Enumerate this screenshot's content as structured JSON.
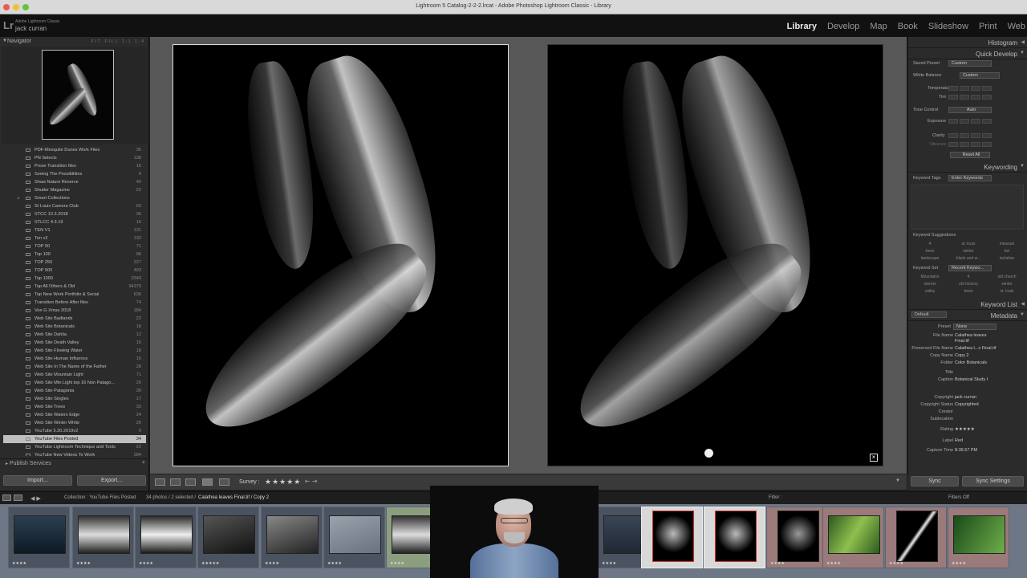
{
  "window": {
    "title": "Lightroom 5 Catalog-2-2-2.lrcat - Adobe Photoshop Lightroom Classic - Library"
  },
  "app": {
    "logo": "Lr",
    "name": "Adobe Lightroom Classic",
    "user": "jack curran"
  },
  "modules": [
    "Library",
    "Develop",
    "Map",
    "Book",
    "Slideshow",
    "Print",
    "Web"
  ],
  "navigator": {
    "title": "Navigator",
    "zoom": "FIT  FILL  1:1  1:4"
  },
  "collections": [
    {
      "name": "PDF-Mesquite Dunes Work Files",
      "count": "35"
    },
    {
      "name": "PN Selects",
      "count": "138"
    },
    {
      "name": "Prose Transition files",
      "count": "16"
    },
    {
      "name": "Seeing The Possibilities",
      "count": "6"
    },
    {
      "name": "Shaw Nature Reserve",
      "count": "40"
    },
    {
      "name": "Shutter Magazine",
      "count": "22"
    },
    {
      "name": "Smart Collections",
      "count": "",
      "expand": "▸"
    },
    {
      "name": "St Louis Camera Club",
      "count": "63"
    },
    {
      "name": "STCC 10.3.2018",
      "count": "36"
    },
    {
      "name": "STLCC 4.3.19",
      "count": "16"
    },
    {
      "name": "TEN V1",
      "count": "131"
    },
    {
      "name": "Ten v2",
      "count": "132"
    },
    {
      "name": "TOP 50",
      "count": "71"
    },
    {
      "name": "Top 100",
      "count": "96"
    },
    {
      "name": "TOP 250",
      "count": "227"
    },
    {
      "name": "TOP 500",
      "count": "493"
    },
    {
      "name": "Top 1000",
      "count": "3343"
    },
    {
      "name": "Top All Others & Old",
      "count": "94370"
    },
    {
      "name": "Top New Work Portfolio & Social",
      "count": "636"
    },
    {
      "name": "Transition Before After files",
      "count": "74"
    },
    {
      "name": "Von G Xmas 2018",
      "count": "184"
    },
    {
      "name": "Web Site Badlands",
      "count": "22"
    },
    {
      "name": "Web Site Botanicals",
      "count": "18"
    },
    {
      "name": "Web Site Dahlia",
      "count": "12"
    },
    {
      "name": "Web Site Death Valley",
      "count": "16"
    },
    {
      "name": "Web Site Flowing Water",
      "count": "18"
    },
    {
      "name": "Web Site Human Influence",
      "count": "16"
    },
    {
      "name": "Web Site In The Name of the Father",
      "count": "28"
    },
    {
      "name": "Web Site Mountain Light",
      "count": "71"
    },
    {
      "name": "Web Site Mtn Light top 16 Non Patago...",
      "count": "20"
    },
    {
      "name": "Web Site Patagonia",
      "count": "30"
    },
    {
      "name": "Web Site Singles",
      "count": "17"
    },
    {
      "name": "Web Site Trees",
      "count": "33"
    },
    {
      "name": "Web Site Waters Edge",
      "count": "24"
    },
    {
      "name": "Web Site Winter White",
      "count": "20"
    },
    {
      "name": "YouTube 5.20.2019v2",
      "count": "6"
    },
    {
      "name": "YouTube Files Posted",
      "count": "34",
      "selected": true
    },
    {
      "name": "YouTube Lightroom Technique and Tools",
      "count": "22"
    },
    {
      "name": "YouTube New Videos To Work",
      "count": "284"
    }
  ],
  "publish": {
    "label": "Publish Services",
    "plus": "+"
  },
  "left_buttons": {
    "import": "Import...",
    "export": "Export..."
  },
  "toolbar": {
    "survey": "Survey :",
    "stars": "★★★★★",
    "arrows": "⇤ ⇥"
  },
  "right_panel": {
    "histogram": "Histogram",
    "quick_develop": "Quick Develop",
    "saved_preset_label": "Saved Preset",
    "saved_preset_value": "Custom",
    "white_balance_label": "White Balance",
    "white_balance_value": "Custom",
    "temperature": "Temperature",
    "tint": "Tint",
    "tone_control": "Tone Control",
    "auto": "Auto",
    "exposure": "Exposure",
    "clarity": "Clarity",
    "vibrance": "Vibrance",
    "reset_all": "Reset All",
    "keywording": "Keywording",
    "keyword_tags_label": "Keyword Tags",
    "keyword_tags_value": "Enter Keywords",
    "keyword_suggestions": "Keyword Suggestions",
    "suggestions": [
      "4",
      "st. louis",
      "missouri",
      "trees",
      "winter",
      "bw",
      "landscape",
      "black and w...",
      "isolation"
    ],
    "keyword_set_label": "Keyword Set",
    "keyword_set_value": "Recent Keywo...",
    "keyword_set_items": [
      "Mountains",
      "4",
      "old church",
      "storms",
      "old hickory",
      "winter",
      "valley",
      "trees",
      "st. louis"
    ],
    "keyword_list": "Keyword List",
    "metadata": "Metadata",
    "metadata_preset_select": "Default",
    "preset_label": "Preset",
    "preset_value": "None",
    "meta": [
      {
        "label": "File Name",
        "value": "Calathea leaves Final.tif"
      },
      {
        "label": "Preserved File Name",
        "value": "Calathea l...s Final.tif"
      },
      {
        "label": "Copy Name",
        "value": "Copy 2"
      },
      {
        "label": "Folder",
        "value": "Color Botanicals"
      },
      {
        "label": "Title",
        "value": ""
      },
      {
        "label": "Caption",
        "value": "Botanical Study I"
      },
      {
        "label": "Copyright",
        "value": "jack curran"
      },
      {
        "label": "Copyright Status",
        "value": "Copyrighted"
      },
      {
        "label": "Creator",
        "value": ""
      },
      {
        "label": "Sublocation",
        "value": ""
      },
      {
        "label": "Rating",
        "value": "★★★★★"
      },
      {
        "label": "Label",
        "value": "Red"
      },
      {
        "label": "Capture Time",
        "value": "8:36:57 PM"
      }
    ]
  },
  "right_buttons": {
    "sync": "Sync",
    "sync_settings": "Sync Settings"
  },
  "filmstrip_bar": {
    "collection": "Collection : YouTube Files Posted",
    "counts": "34 photos / 2 selected /",
    "current_file": "Calathea leaves Final.tif / Copy 2",
    "filter_label": "Filter :",
    "filters_off": "Filters Off"
  },
  "filmstrip": [
    {
      "stars": "★★★★"
    },
    {
      "stars": "★★★★"
    },
    {
      "stars": "★★★★"
    },
    {
      "stars": "★★★★★"
    },
    {
      "stars": "★★★★"
    },
    {
      "stars": "★★★★"
    },
    {
      "stars": "★★★★"
    },
    {
      "stars": "★★★★"
    },
    {
      "stars": "★★★★★"
    },
    {
      "stars": "★★★★★"
    },
    {
      "stars": "★★★★"
    },
    {
      "stars": "★★★★"
    },
    {
      "stars": "★★★★"
    },
    {
      "stars": "★★★★"
    }
  ]
}
